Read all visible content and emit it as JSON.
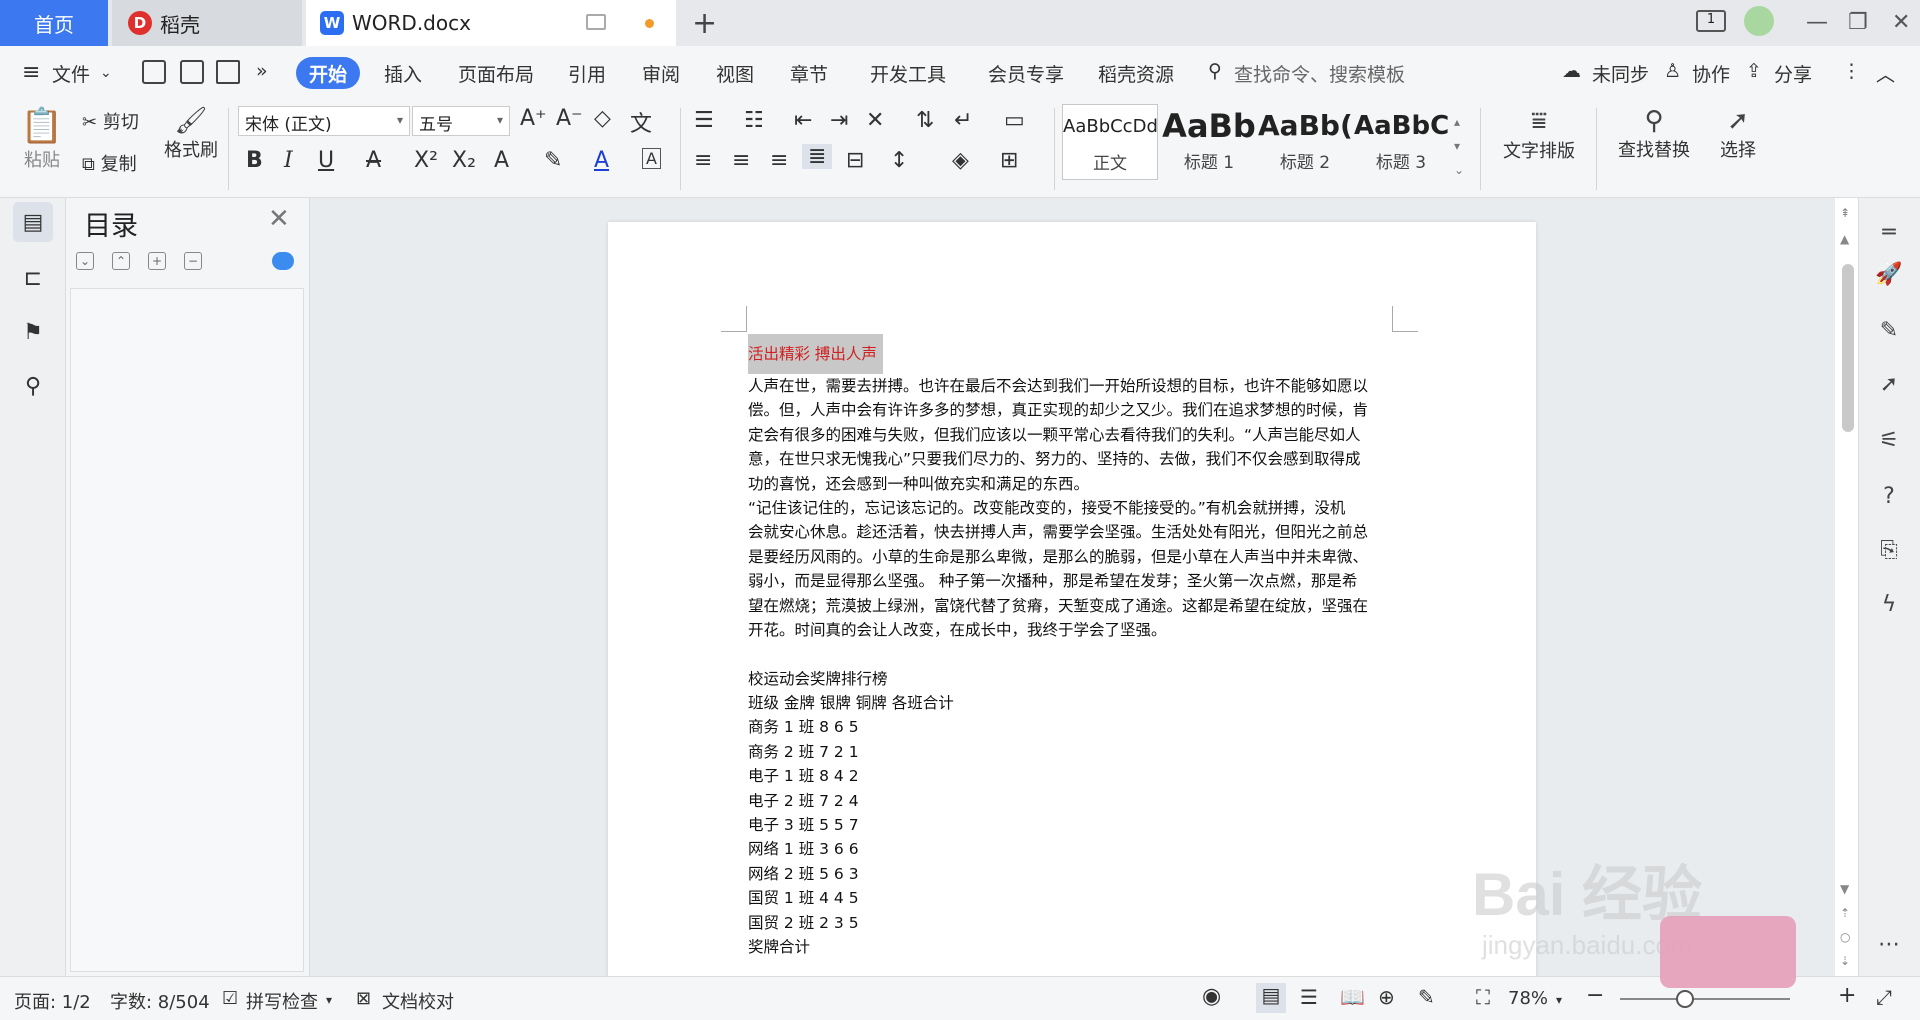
{
  "tabs": {
    "home": "首页",
    "docer": "稻壳",
    "doc": "WORD.docx",
    "docer_logo": "D",
    "word_logo": "W"
  },
  "window": {
    "badge": "1"
  },
  "menu": {
    "file": "文件",
    "start": "开始",
    "items": [
      "插入",
      "页面布局",
      "引用",
      "审阅",
      "视图",
      "章节",
      "开发工具",
      "会员专享",
      "稻壳资源"
    ],
    "search_placeholder": "查找命令、搜索模板",
    "sync": "未同步",
    "collab": "协作",
    "share": "分享"
  },
  "ribbon": {
    "paste": "粘贴",
    "cut": "剪切",
    "copy": "复制",
    "format_painter": "格式刷",
    "font_name": "宋体 (正文)",
    "font_size": "五号",
    "styles": [
      {
        "sample": "AaBbCcDd",
        "label": "正文"
      },
      {
        "sample": "AaBb",
        "label": "标题 1"
      },
      {
        "sample": "AaBb(",
        "label": "标题 2"
      },
      {
        "sample": "AaBbC",
        "label": "标题 3"
      }
    ],
    "text_layout": "文字排版",
    "find_replace": "查找替换",
    "select": "选择"
  },
  "toc": {
    "title": "目录"
  },
  "document": {
    "title": "活出精彩  搏出人声",
    "lines": [
      "人声在世，需要去拼搏。也许在最后不会达到我们一开始所设想的目标，也许不能够如愿以",
      "偿。但，人声中会有许许多多的梦想，真正实现的却少之又少。我们在追求梦想的时候，肯",
      "定会有很多的困难与失败，但我们应该以一颗平常心去看待我们的失利。“人声岂能尽如人",
      "意，在世只求无愧我心”只要我们尽力的、努力的、坚持的、去做，我们不仅会感到取得成",
      "功的喜悦，还会感到一种叫做充实和满足的东西。",
      "“记住该记住的，忘记该忘记的。改变能改变的，接受不能接受的。”有机会就拼搏，没机",
      "会就安心休息。趁还活着，快去拼搏人声，需要学会坚强。生活处处有阳光，但阳光之前总",
      "是要经历风雨的。小草的生命是那么卑微，是那么的脆弱，但是小草在人声当中并未卑微、",
      "弱小，而是显得那么坚强。 种子第一次播种，那是希望在发芽；圣火第一次点燃，那是希",
      "望在燃烧；荒漠披上绿洲，富饶代替了贫瘠，天堑变成了通途。这都是希望在绽放，坚强在",
      "开花。时间真的会让人改变，在成长中，我终于学会了坚强。",
      "",
      "校运动会奖牌排行榜",
      "班级  金牌  银牌  铜牌  各班合计",
      "商务 1 班  8 6 5",
      "商务 2 班  7 2 1",
      "电子 1 班  8 4 2",
      "电子 2 班  7 2 4",
      "电子 3 班  5 5 7",
      "网络 1 班  3 6 6",
      "网络 2 班  5 6 3",
      "国贸 1 班  4 4 5",
      "国贸 2 班  2 3 5",
      "奖牌合计"
    ]
  },
  "status": {
    "page": "页面: 1/2",
    "words": "字数: 8/504",
    "spell": "拼写检查",
    "proof": "文档校对",
    "zoom": "78%",
    "zoom_fraction": 0.38
  },
  "watermark": {
    "brand": "Bai",
    "cn": "经验",
    "url": "jingyan.baidu.com"
  },
  "colors": {
    "accent": "#3c79f0",
    "title_red": "#d12020"
  }
}
